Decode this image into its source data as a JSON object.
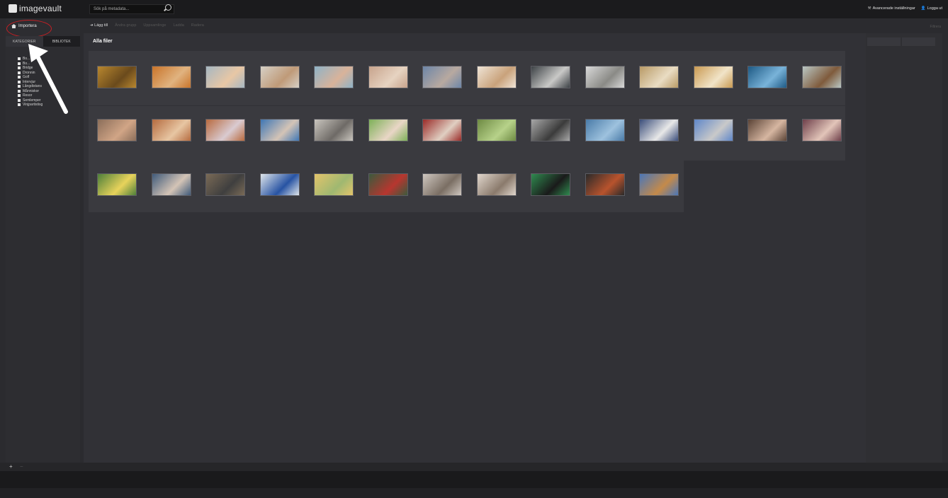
{
  "header": {
    "logo_text": "imagevault",
    "search_placeholder": "Sök på metadata...",
    "advanced_settings": "Avancerade inställningar",
    "logout": "Logga ut"
  },
  "sidebar": {
    "import_label": "Importera",
    "tabs": [
      "KATEGORIER",
      "BIBLIOTEK"
    ],
    "categories": [
      "Bo...",
      "Bo...",
      "Bridge",
      "Dronnin",
      "Golf",
      "Intervjur",
      "Långdistans",
      "Månniskor",
      "Resor",
      "Semlemper",
      "Vinjpartistisg"
    ]
  },
  "toolbar": {
    "add_label": "Lägg till",
    "dim_items": [
      "Ändra grupp",
      "Uppsamlinge",
      "Ladda",
      "Radera"
    ],
    "right_item": "Filtrera"
  },
  "main": {
    "title": "Alla filer"
  },
  "thumbnails": {
    "rows": [
      [
        [
          "#b8872f",
          "#6a4a1c"
        ],
        [
          "#c9742a",
          "#e0b380"
        ],
        [
          "#a6b7c2",
          "#e8c7a5"
        ],
        [
          "#d6d0c6",
          "#bf9a78"
        ],
        [
          "#8fb3c7",
          "#d9b39a"
        ],
        [
          "#c7a38c",
          "#e6d3c1"
        ],
        [
          "#6d86a8",
          "#b8a9a0"
        ],
        [
          "#efe4d6",
          "#c9a27b"
        ],
        [
          "#3d4246",
          "#c9c9c7"
        ],
        [
          "#d9d9d9",
          "#8a8a86"
        ],
        [
          "#b89a66",
          "#e9dcc3"
        ],
        [
          "#c99a52",
          "#f1e4c8"
        ],
        [
          "#1e5a85",
          "#79b3d9"
        ],
        [
          "#b9c7c4",
          "#7f5b3c"
        ]
      ],
      [
        [
          "#8b6e5a",
          "#d1a586"
        ],
        [
          "#b56b3f",
          "#e7c6a3"
        ],
        [
          "#b86a3f",
          "#d9cbd1"
        ],
        [
          "#3f77b5",
          "#d4c4b6"
        ],
        [
          "#c9c5be",
          "#6e6a66"
        ],
        [
          "#7db058",
          "#e9d6c6"
        ],
        [
          "#9a2b28",
          "#e0cfc2"
        ],
        [
          "#6e8a43",
          "#b7d28a"
        ],
        [
          "#a8a8a8",
          "#3b3b3b"
        ],
        [
          "#4a7ba8",
          "#9ec2de"
        ],
        [
          "#3a4d7a",
          "#e8e8e8"
        ],
        [
          "#5f87c9",
          "#c9c9c9"
        ],
        [
          "#5a4336",
          "#d6b6a1"
        ],
        [
          "#6e3f4a",
          "#e2c5b9"
        ]
      ],
      [
        [
          "#4d7f3a",
          "#e8d35b"
        ],
        [
          "#3f5a7a",
          "#d4c4b6"
        ],
        [
          "#7a6a56",
          "#3f3f3f"
        ],
        [
          "#dfe5ea",
          "#2753a3"
        ],
        [
          "#e3c46b",
          "#9fb871"
        ],
        [
          "#3b5a3d",
          "#b7362f"
        ],
        [
          "#cfc7c0",
          "#7a6e63"
        ],
        [
          "#e0d6cc",
          "#8a7a6c"
        ],
        [
          "#2f8a4f",
          "#1a1a1a"
        ],
        [
          "#2a2a2a",
          "#b8532d"
        ],
        [
          "#4a76b8",
          "#c48a4a"
        ]
      ]
    ]
  }
}
